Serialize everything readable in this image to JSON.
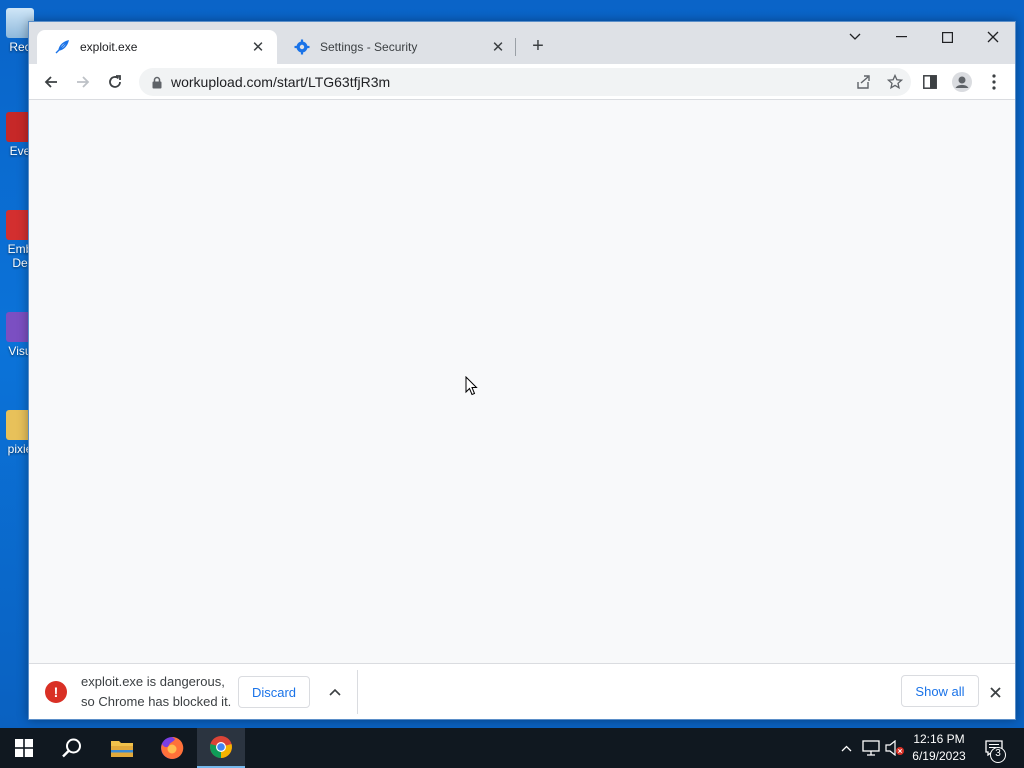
{
  "desktop": {
    "icons": [
      {
        "label": "Rec"
      },
      {
        "label": "Eve"
      },
      {
        "label": "Emb"
      },
      {
        "label": "De"
      },
      {
        "label": "Visu"
      },
      {
        "label": "pixie"
      }
    ]
  },
  "browser": {
    "tabs": [
      {
        "title": "exploit.exe",
        "icon": "feather-icon",
        "active": true
      },
      {
        "title": "Settings - Security",
        "icon": "gear-icon",
        "active": false
      }
    ],
    "url": "workupload.com/start/LTG63tfjR3m"
  },
  "download_shelf": {
    "warning_line1": "exploit.exe is dangerous,",
    "warning_line2": "so Chrome has blocked it.",
    "discard_label": "Discard",
    "show_all_label": "Show all"
  },
  "taskbar": {
    "time": "12:16 PM",
    "date": "6/19/2023",
    "notification_count": "3"
  },
  "colors": {
    "desktop_bg": "#0a64c8",
    "accent": "#1a73e8",
    "danger": "#d93025"
  }
}
